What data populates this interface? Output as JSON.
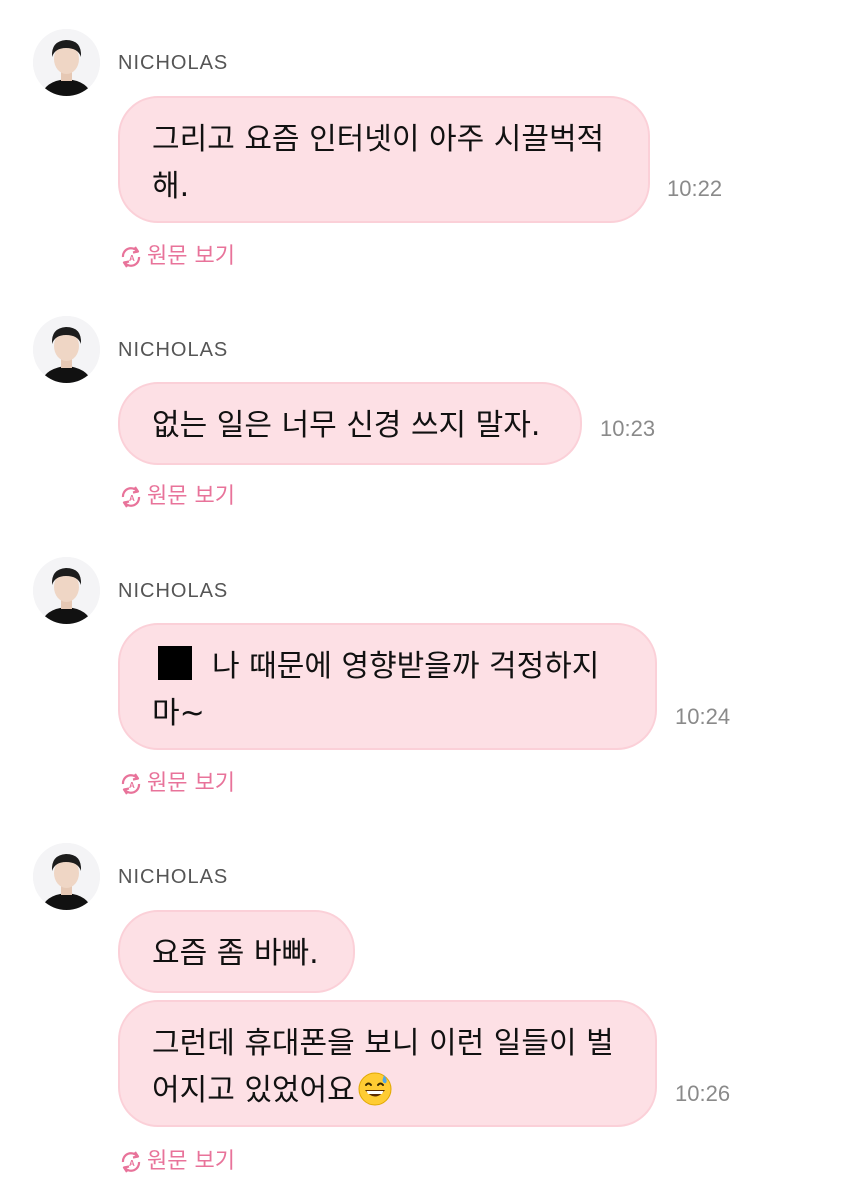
{
  "sender": {
    "name": "NICHOLAS",
    "avatar_icon": "person-avatar-icon"
  },
  "accent_color": "#e8739a",
  "bubble_color": "#fde0e5",
  "translate_link": {
    "label": "원문 보기",
    "icon": "translate-icon"
  },
  "messages": [
    {
      "lines": [
        "그리고 요즘 인터넷이 아주 시끌벅적",
        "해."
      ],
      "time": "10:22"
    },
    {
      "lines": [
        "없는 일은 너무 신경 쓰지 말자."
      ],
      "time": "10:23"
    },
    {
      "lines": [
        "나 때문에 영향받을까 걱정하지",
        "마~"
      ],
      "time": "10:24",
      "redacted_prefix": true
    },
    {
      "lines": [
        "요즘 좀 바빠."
      ]
    },
    {
      "lines": [
        "그런데 휴대폰을 보니 이런 일들이 벌",
        "어지고 있었어요"
      ],
      "time": "10:26",
      "emoji": "grinning-face-with-sweat-icon"
    }
  ]
}
